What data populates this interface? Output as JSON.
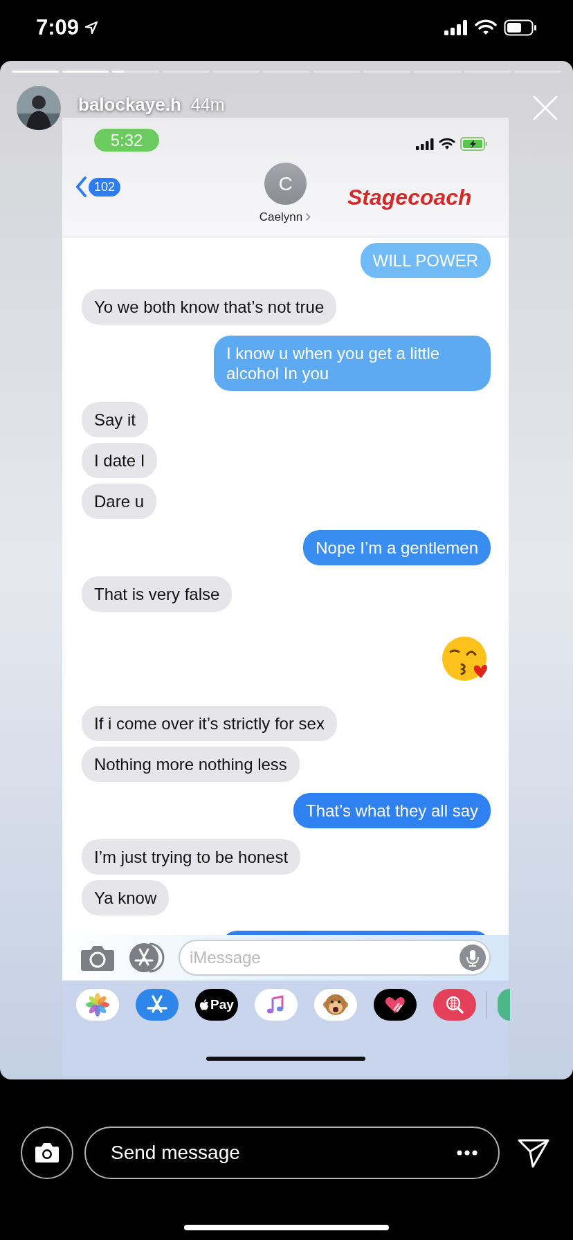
{
  "status_bar": {
    "time": "7:09"
  },
  "story": {
    "progress": [
      {
        "level": 1
      },
      {
        "level": 1
      },
      {
        "level": 0.25
      },
      {
        "level": 0
      },
      {
        "level": 0
      },
      {
        "level": 0
      },
      {
        "level": 0
      },
      {
        "level": 0
      },
      {
        "level": 0
      },
      {
        "level": 0
      },
      {
        "level": 0
      }
    ],
    "username": "balockaye.h",
    "age": "44m"
  },
  "screenshot": {
    "time": "5:32",
    "back_count": "102",
    "contact_initial": "C",
    "contact_name": "Caelynn",
    "sticker": "Stagecoach",
    "messages": [
      {
        "kind": "text",
        "outgoing": true,
        "text": "WILL POWER"
      },
      {
        "kind": "text",
        "outgoing": false,
        "text": "Yo we both know that’s not true"
      },
      {
        "kind": "text",
        "outgoing": true,
        "text": "I know u when you get a little alcohol In you"
      },
      {
        "kind": "text",
        "outgoing": false,
        "text": "Say it"
      },
      {
        "kind": "text",
        "outgoing": false,
        "text": "I date I"
      },
      {
        "kind": "text",
        "outgoing": false,
        "text": "Dare u"
      },
      {
        "kind": "text",
        "outgoing": true,
        "text": "Nope I’m a gentlemen"
      },
      {
        "kind": "text",
        "outgoing": false,
        "text": "That is very false"
      },
      {
        "kind": "emoji",
        "outgoing": true
      },
      {
        "kind": "text",
        "outgoing": false,
        "text": "If i come over it’s strictly for sex"
      },
      {
        "kind": "text",
        "outgoing": false,
        "text": "Nothing more nothing less"
      },
      {
        "kind": "text",
        "outgoing": true,
        "text": "That’s what they all say"
      },
      {
        "kind": "text",
        "outgoing": false,
        "text": "I’m just trying to be honest"
      },
      {
        "kind": "text",
        "outgoing": false,
        "text": "Ya know"
      },
      {
        "kind": "partial",
        "outgoing": true
      }
    ],
    "input": {
      "placeholder": "iMessage"
    },
    "apps": [
      {
        "kind": "photos"
      },
      {
        "kind": "appstore"
      },
      {
        "kind": "applepay",
        "label": "Pay"
      },
      {
        "kind": "music"
      },
      {
        "kind": "animoji"
      },
      {
        "kind": "heart"
      },
      {
        "kind": "websearch"
      },
      {
        "kind": "partial"
      }
    ]
  },
  "reply": {
    "placeholder": "Send message"
  }
}
